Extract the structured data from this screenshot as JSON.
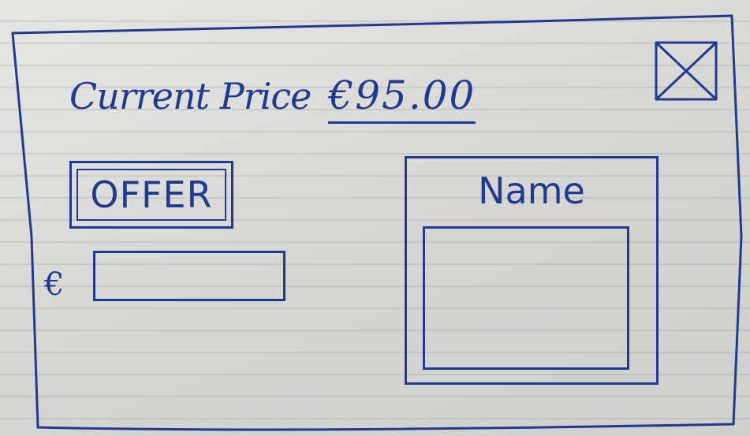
{
  "window": {
    "price_label": "Current Price",
    "price_value": "€95.00"
  },
  "offer": {
    "button_label": "OFFER",
    "currency_symbol": "€",
    "input_value": ""
  },
  "name_panel": {
    "title": "Name",
    "input_value": ""
  },
  "icons": {
    "close": "close-icon"
  },
  "colors": {
    "ink": "#1f3a93",
    "paper": "#d9d9d6"
  }
}
